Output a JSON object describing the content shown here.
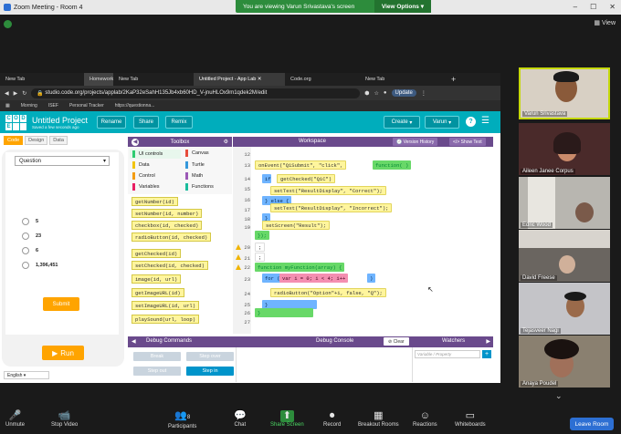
{
  "zoom": {
    "window_title": "Zoom Meeting - Room 4",
    "banner_text": "You are viewing Varun Srivastava's screen",
    "view_options": "View Options",
    "view_label": "View",
    "controls": [
      {
        "label": "Unmute",
        "icon": "🎤"
      },
      {
        "label": "Stop Video",
        "icon": "📹"
      },
      {
        "label": "Participants",
        "icon": "👥",
        "count": "8"
      },
      {
        "label": "Chat",
        "icon": "💬"
      },
      {
        "label": "Share Screen",
        "icon": "⬆"
      },
      {
        "label": "Record",
        "icon": "⏺"
      },
      {
        "label": "Breakout Rooms",
        "icon": "▦"
      },
      {
        "label": "Reactions",
        "icon": "☺"
      },
      {
        "label": "Whiteboards",
        "icon": "▭"
      }
    ],
    "leave_label": "Leave Room",
    "participants": [
      {
        "name": "Varun Srivastava",
        "active": true
      },
      {
        "name": "Aileen Janee Corpus",
        "active": false
      },
      {
        "name": "Edric Wood",
        "active": false
      },
      {
        "name": "David Freese",
        "active": false
      },
      {
        "name": "Tejasveer Nagi",
        "active": false
      },
      {
        "name": "Anaya Poudel",
        "active": false
      }
    ]
  },
  "browser": {
    "tabs": [
      "New Tab",
      "Homework",
      "New Tab",
      "Untitled Project - App Lab",
      "Code.org",
      "New Tab"
    ],
    "url": "studio.code.org/projects/applab/2KaP32eSahH135Jb4xb60HD_V-jnuHLOx9m1qdek2M/edit",
    "update_label": "Update",
    "bookmarks": [
      "Morning",
      "ISEF",
      "Personal Tracker",
      "https://questionna..."
    ]
  },
  "applab": {
    "logo_letters": [
      "C",
      "O",
      "D",
      "E",
      "",
      "",
      ""
    ],
    "project_title": "Untitled Project",
    "project_subtitle": "Saved a few seconds ago",
    "buttons": {
      "rename": "Rename",
      "share": "Share",
      "remix": "Remix",
      "create": "Create",
      "user": "Varun"
    },
    "modes": [
      "Code",
      "Design",
      "Data"
    ],
    "dropdown_value": "Question",
    "choices": [
      "5",
      "23",
      "6",
      "1,396,451"
    ],
    "submit_label": "Submit",
    "run_label": "Run",
    "language": "English",
    "toolbox": {
      "title": "Toolbox",
      "categories": [
        {
          "name": "UI controls",
          "color": "#2ecc71"
        },
        {
          "name": "Canvas",
          "color": "#e74c3c"
        },
        {
          "name": "Data",
          "color": "#f1c40f"
        },
        {
          "name": "Turtle",
          "color": "#3498db"
        },
        {
          "name": "Control",
          "color": "#f39c12"
        },
        {
          "name": "Math",
          "color": "#9b59b6"
        },
        {
          "name": "Variables",
          "color": "#e91e63"
        },
        {
          "name": "Functions",
          "color": "#1abc9c"
        }
      ],
      "blocks": [
        "getNumber(id)",
        "setNumber(id, number)",
        "checkbox(id, checked)",
        "radioButton(id, checked)",
        "getChecked(id)",
        "setChecked(id, checked)",
        "image(id, url)",
        "getImageURL(id)",
        "setImageURL(id, url)",
        "playSound(url, loop)"
      ]
    },
    "workspace": {
      "title": "Workspace",
      "version_history": "Version History",
      "show_text": "Show Text",
      "line_numbers": [
        "12",
        "13",
        "14",
        "15",
        "16",
        "17",
        "18",
        "19",
        "20",
        "21",
        "22",
        "23",
        "24",
        "25",
        "26",
        "27"
      ],
      "code": {
        "on_event": "onEvent(\"Q1Submit\", \"click\",",
        "function_kw": "function( )",
        "if_kw": "if",
        "get_checked": "getChecked(\"Q1C\")",
        "set_correct": "setText(\"ResultDisplay\", \"Correct\");",
        "else_kw": "} else {",
        "set_incorrect": "setText(\"ResultDisplay\", \"Incorrect\");",
        "close_brace": "}",
        "set_screen": "setScreen(\"Result\");",
        "close_event": "});",
        "semi1": ";",
        "semi2": ";",
        "my_function": "function myFunction(array) {",
        "for_kw": "for (",
        "for_var": "var i = 0; i < 4; i++",
        "for_close": ")",
        "radio_call": "radioButton(\"Option\"+i, false, \"Q\");",
        "close_for": "}",
        "close_fn": "}"
      }
    },
    "debug": {
      "commands_title": "Debug Commands",
      "console_title": "Debug Console",
      "watchers_title": "Watchers",
      "clear_label": "Clear",
      "buttons": [
        "Break",
        "Step over",
        "Step out",
        "Step in"
      ],
      "watch_placeholder": "Variable / Property",
      "add_label": "+"
    }
  }
}
